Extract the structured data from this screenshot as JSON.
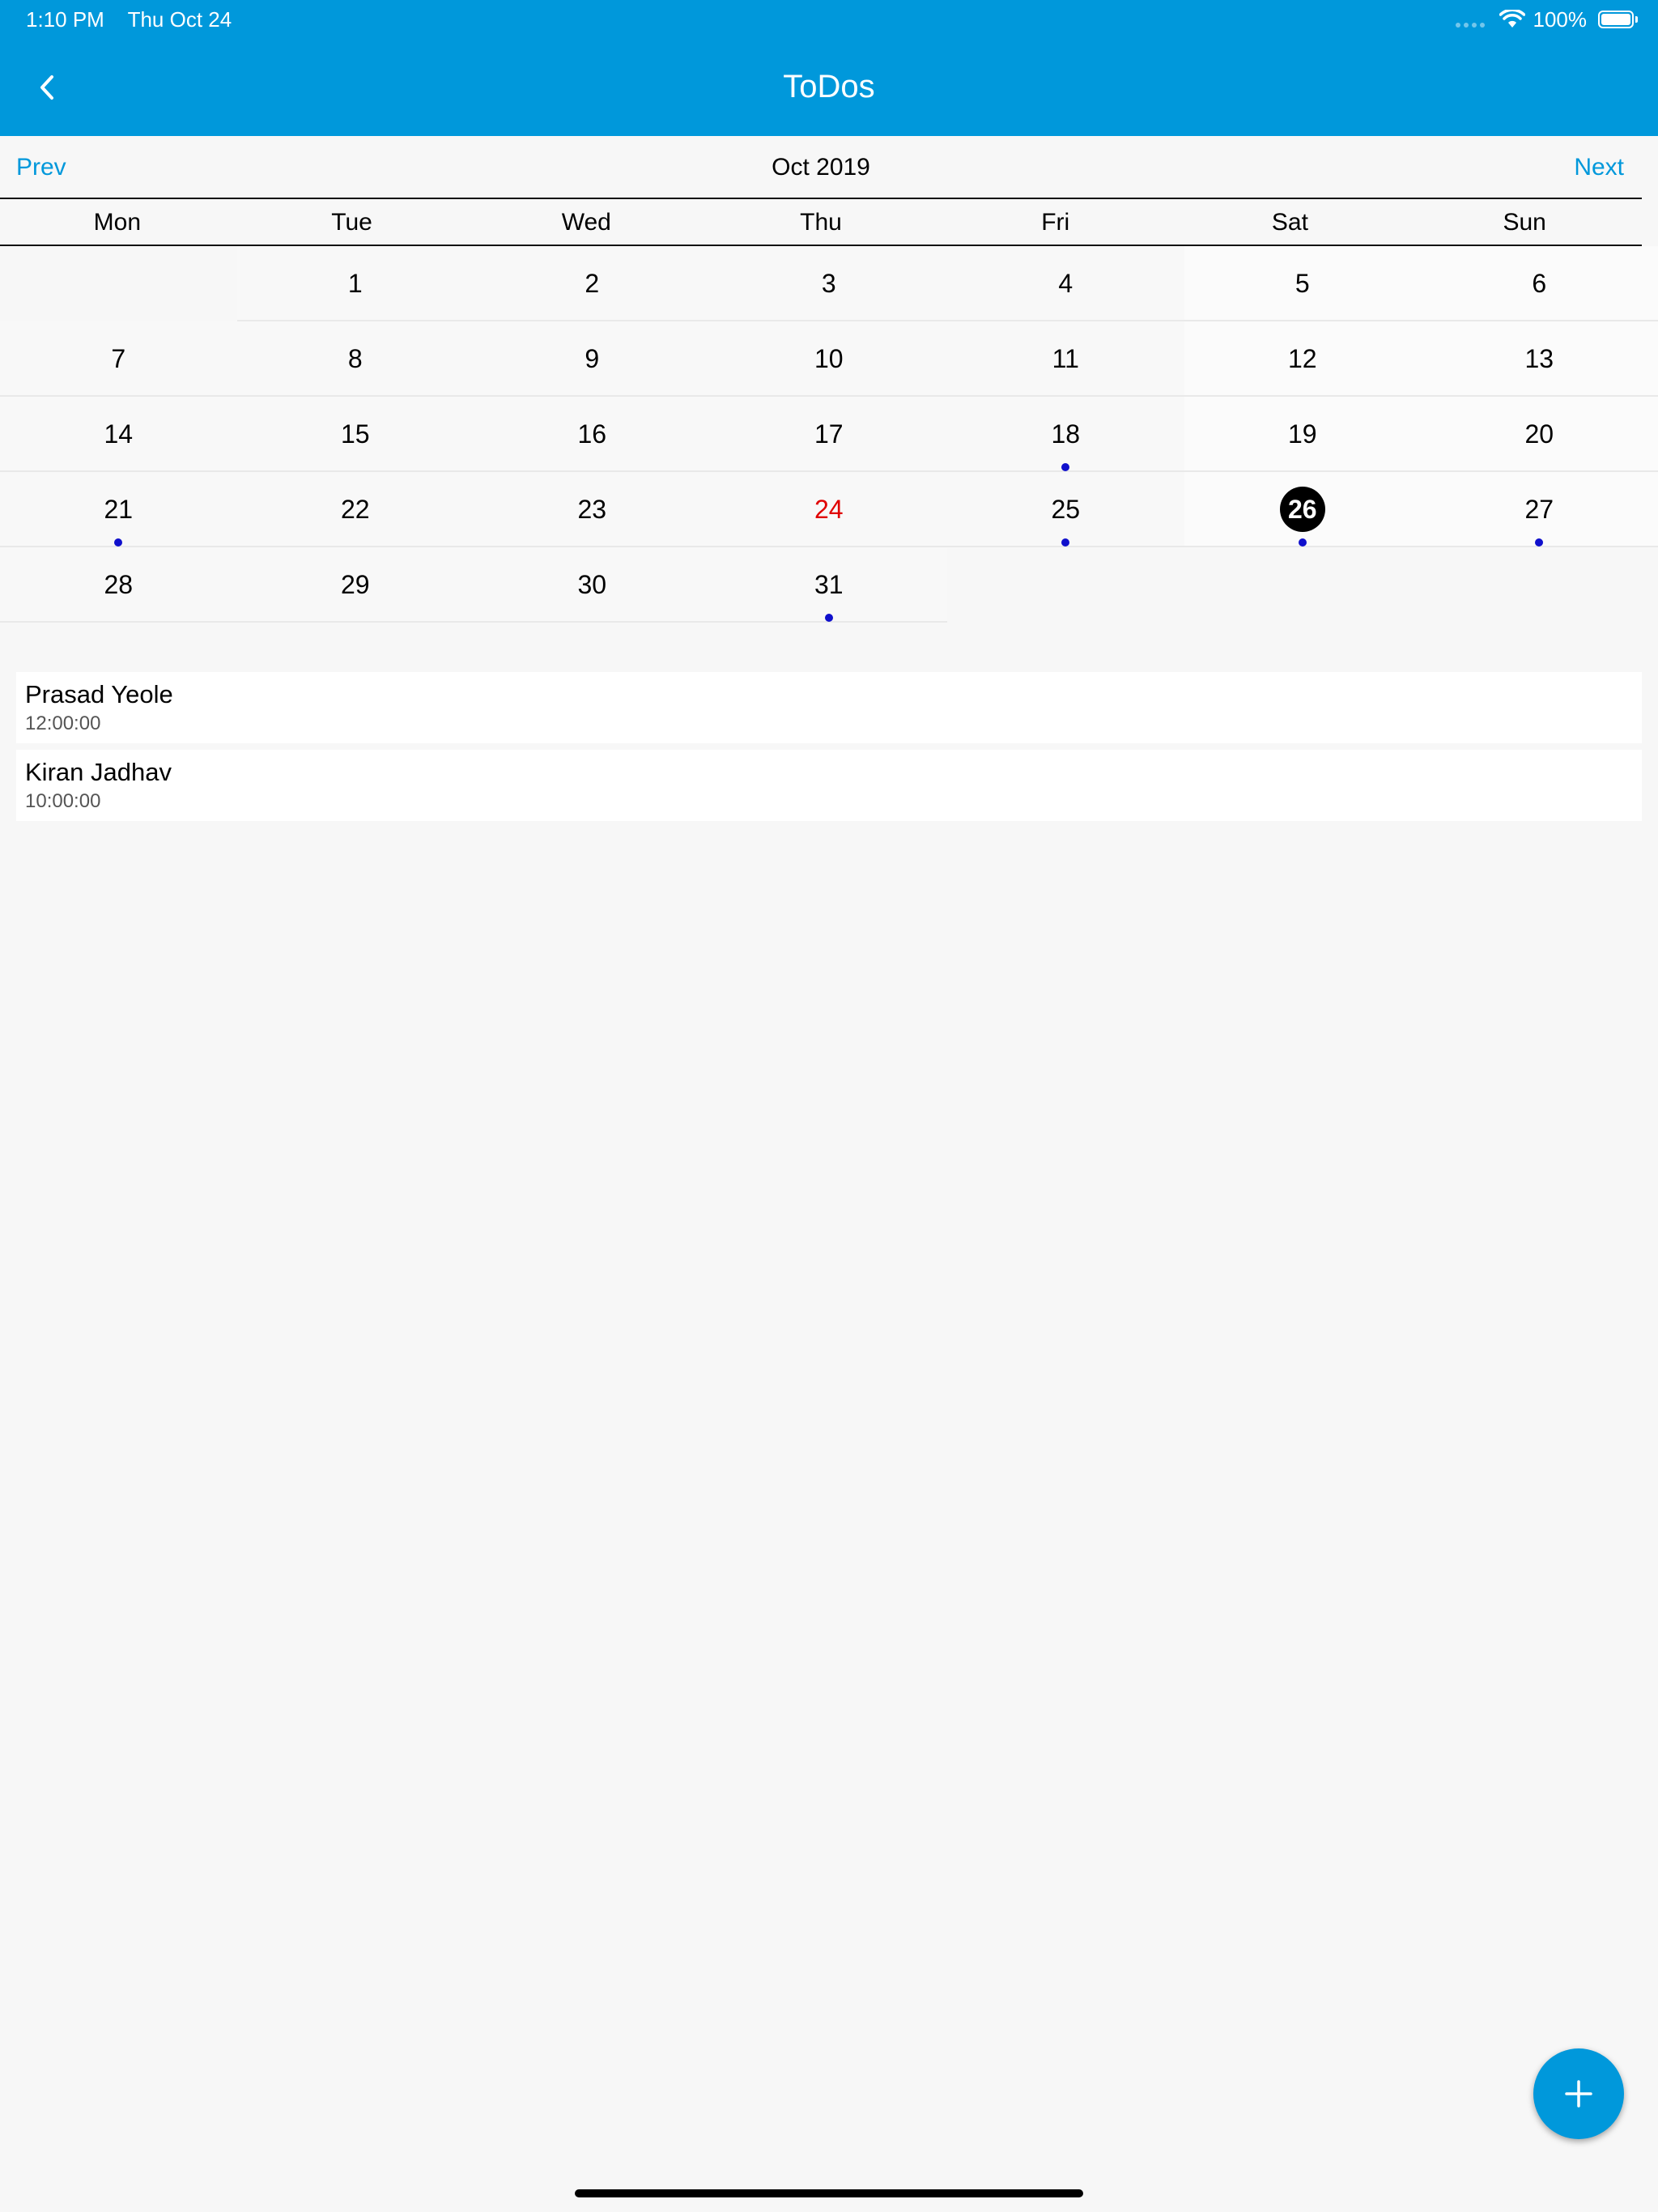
{
  "status_bar": {
    "time": "1:10 PM",
    "date": "Thu Oct 24",
    "battery": "100%"
  },
  "header": {
    "title": "ToDos"
  },
  "calendar": {
    "prev_label": "Prev",
    "next_label": "Next",
    "month_label": "Oct 2019",
    "weekdays": [
      "Mon",
      "Tue",
      "Wed",
      "Thu",
      "Fri",
      "Sat",
      "Sun"
    ],
    "weeks": [
      [
        "",
        "1",
        "2",
        "3",
        "4",
        "5",
        "6"
      ],
      [
        "7",
        "8",
        "9",
        "10",
        "11",
        "12",
        "13"
      ],
      [
        "14",
        "15",
        "16",
        "17",
        "18",
        "19",
        "20"
      ],
      [
        "21",
        "22",
        "23",
        "24",
        "25",
        "26",
        "27"
      ],
      [
        "28",
        "29",
        "30",
        "31",
        "",
        "",
        ""
      ]
    ],
    "today": "24",
    "selected": "26",
    "event_days": [
      "18",
      "21",
      "25",
      "26",
      "27",
      "31"
    ],
    "colors": {
      "accent": "#0098db",
      "today": "#e00000",
      "event_dot": "#1010cc"
    }
  },
  "events": [
    {
      "name": "Prasad Yeole",
      "time": "12:00:00"
    },
    {
      "name": "Kiran Jadhav",
      "time": "10:00:00"
    }
  ],
  "fab": {
    "icon": "plus-icon"
  }
}
